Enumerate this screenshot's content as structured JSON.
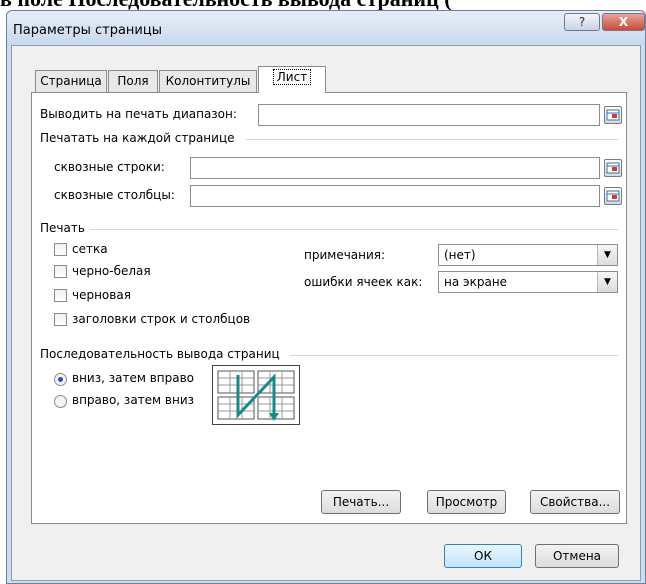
{
  "background_text": "в поле Последовательность вывода страниц (",
  "dialog": {
    "title": "Параметры страницы",
    "help_symbol": "?",
    "close_symbol": "X"
  },
  "tabs": [
    {
      "label": "Страница",
      "active": false
    },
    {
      "label": "Поля",
      "active": false
    },
    {
      "label": "Колонтитулы",
      "active": false
    },
    {
      "label": "Лист",
      "active": true
    }
  ],
  "sheet": {
    "print_area_label": "Выводить на печать диапазон:",
    "print_area_value": "",
    "repeat_group_label": "Печатать на каждой странице",
    "rows_label": "сквозные строки:",
    "rows_value": "",
    "cols_label": "сквозные столбцы:",
    "cols_value": "",
    "print_group_label": "Печать",
    "gridlines_label": "сетка",
    "bw_label": "черно-белая",
    "draft_label": "черновая",
    "headings_label": "заголовки строк и столбцов",
    "comments_label": "примечания:",
    "comments_value": "(нет)",
    "errors_label": "ошибки ячеек как:",
    "errors_value": "на экране",
    "order_group_label": "Последовательность вывода страниц",
    "order_down_label": "вниз, затем вправо",
    "order_over_label": "вправо, затем вниз",
    "order_selected": "down_then_over",
    "checkbox_states": {
      "gridlines": false,
      "bw": false,
      "draft": false,
      "headings": false
    }
  },
  "buttons": {
    "print": "Печать...",
    "preview": "Просмотр",
    "properties": "Свойства...",
    "ok": "ОК",
    "cancel": "Отмена"
  },
  "colors": {
    "accent": "#1c5bb5",
    "order_arrow": "#1a8a86",
    "close": "#c64b3b"
  }
}
